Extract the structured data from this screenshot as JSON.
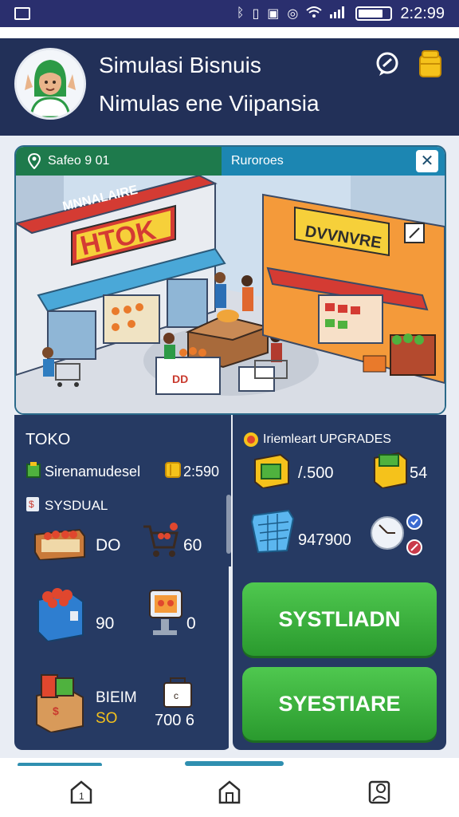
{
  "status_bar": {
    "time": "2:2:99",
    "icons": [
      "image-icon",
      "bluetooth-icon",
      "vibrate-icon",
      "sim-icon",
      "alarm-icon",
      "wifi-icon",
      "signal-icon",
      "battery-icon"
    ]
  },
  "header": {
    "title": "Simulasi Bisnuis",
    "subtitle": "Nimulas ene Viipansia",
    "avatar": "shopkeeper-avatar",
    "actions": [
      "chat-icon",
      "coin-stack-icon"
    ]
  },
  "scene": {
    "tab_left": "Safeo 9 01",
    "tab_right": "Ruroroes",
    "close_label": "✕",
    "shop_left_sign": "HTOK",
    "shop_left_banner": "MNNALAIRE",
    "shop_right_sign": "DVVNVRE",
    "counter_label": "DD"
  },
  "toko": {
    "title": "TOKO",
    "stock_label": "Sirenamudesel",
    "stock_value": "2:590",
    "section_label": "SYSDUAL",
    "items": [
      {
        "icon": "produce-crate-icon",
        "value": "DO"
      },
      {
        "icon": "shopping-cart-icon",
        "value": "60"
      },
      {
        "icon": "fruit-box-icon",
        "value": "90"
      },
      {
        "icon": "cash-register-icon",
        "value": "0"
      },
      {
        "icon": "grocery-box-icon",
        "label": "BIEIM",
        "value": "SO"
      },
      {
        "icon": "bag-icon",
        "value": "700 6"
      }
    ]
  },
  "upgrades": {
    "title": "Iriemleart UPGRADES",
    "items": [
      {
        "icon": "cash-box-icon",
        "value": "/.500"
      },
      {
        "icon": "money-box-icon",
        "value": "54"
      },
      {
        "icon": "basket-icon",
        "value": "947900"
      }
    ],
    "buttons": [
      "SYSTLIADN",
      "SYESTIARE"
    ]
  },
  "nav": {
    "items": [
      "home-icon",
      "store-icon",
      "profile-icon"
    ],
    "home_label": "1"
  },
  "colors": {
    "header_bg": "#223058",
    "panel_bg": "#263a63",
    "accent_green": "#3fb544",
    "accent_blue": "#1c86b2"
  }
}
